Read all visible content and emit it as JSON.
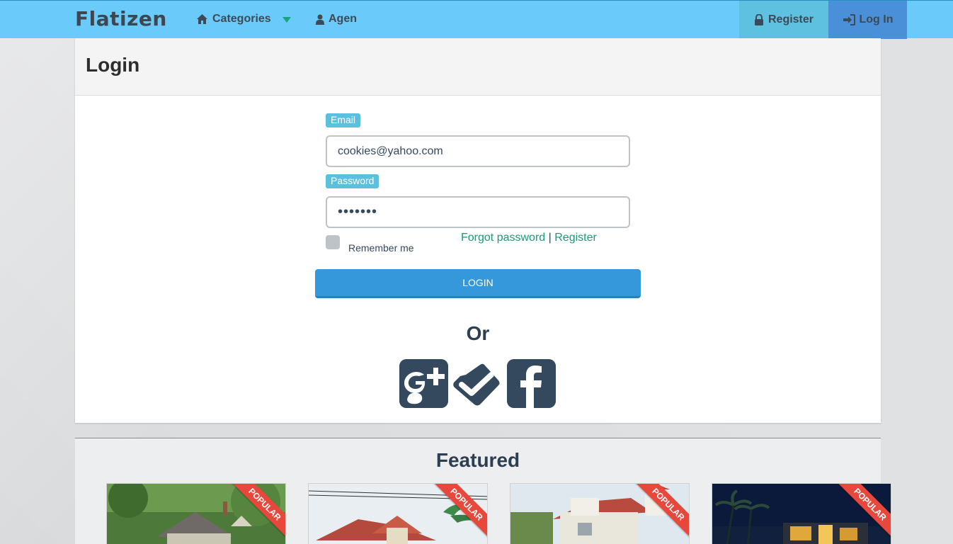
{
  "navbar": {
    "brand": "Flatizen",
    "categories_label": "Categories",
    "agen_label": "Agen",
    "register_label": "Register",
    "login_label": "Log In"
  },
  "login": {
    "title": "Login",
    "email_label": "Email",
    "email_value": "cookies@yahoo.com",
    "password_label": "Password",
    "password_value": "•••••••",
    "remember_label": "Remember me",
    "forgot_link": "Forgot password",
    "separator": "|",
    "register_link": "Register",
    "login_button": "LOGIN",
    "or_text": "Or",
    "social": [
      "google-plus-icon",
      "foursquare-check-icon",
      "facebook-icon"
    ]
  },
  "featured": {
    "title": "Featured",
    "cards": [
      {
        "badge": "POPULAR"
      },
      {
        "badge": "POPULAR"
      },
      {
        "badge": "POPULAR"
      },
      {
        "badge": "POPULAR"
      }
    ]
  },
  "colors": {
    "navbar": "#6acbfa",
    "accent_blue": "#3498db",
    "label_blue": "#5bc0de",
    "link_green": "#1a9b74",
    "ribbon_red": "#e8473c",
    "dark_slate": "#34495e"
  }
}
